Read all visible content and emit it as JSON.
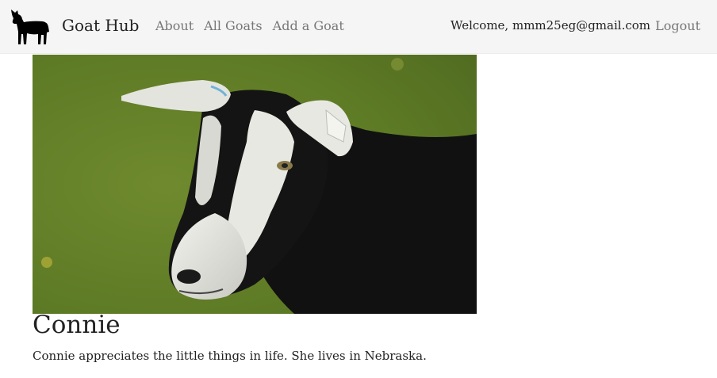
{
  "navbar": {
    "logo_icon": "goat-silhouette-icon",
    "brand": "Goat Hub",
    "links": [
      {
        "label": "About"
      },
      {
        "label": "All Goats"
      },
      {
        "label": "Add a Goat"
      }
    ],
    "welcome": "Welcome, mmm25eg@gmail.com",
    "logout": "Logout",
    "background_color": "#f5f5f5"
  },
  "goat": {
    "image_subject": "black-and-white-goat-photo",
    "name": "Connie",
    "description": "Connie appreciates the little things in life. She lives in Nebraska."
  }
}
